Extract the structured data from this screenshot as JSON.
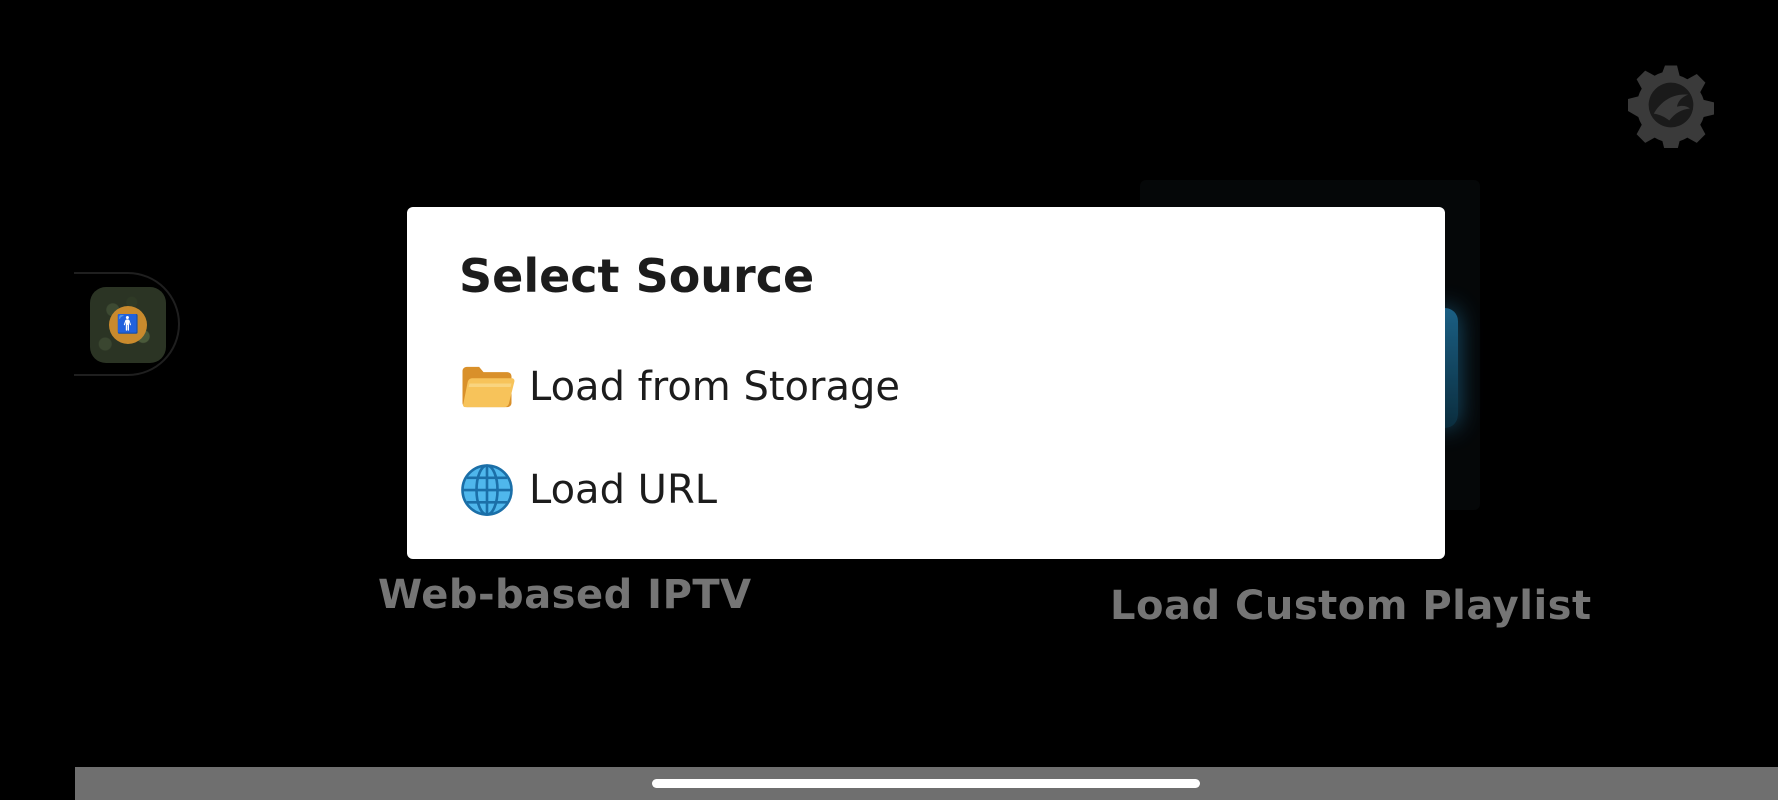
{
  "background": {
    "left_card_label": "Web-based IPTV",
    "right_card_label": "Load Custom Playlist",
    "settings_icon": "gear-icon",
    "accessibility_icon": "accessibility-icon"
  },
  "dialog": {
    "title": "Select Source",
    "options": [
      {
        "label": "Load from Storage",
        "icon": "folder-icon"
      },
      {
        "label": "Load URL",
        "icon": "globe-icon"
      }
    ]
  },
  "colors": {
    "dialog_bg": "#ffffff",
    "backdrop": "#000000",
    "muted_label": "#757575",
    "text": "#1c1c1c",
    "accent_glow": "#1b5f82",
    "accessibility_button": "#c98a2d"
  }
}
